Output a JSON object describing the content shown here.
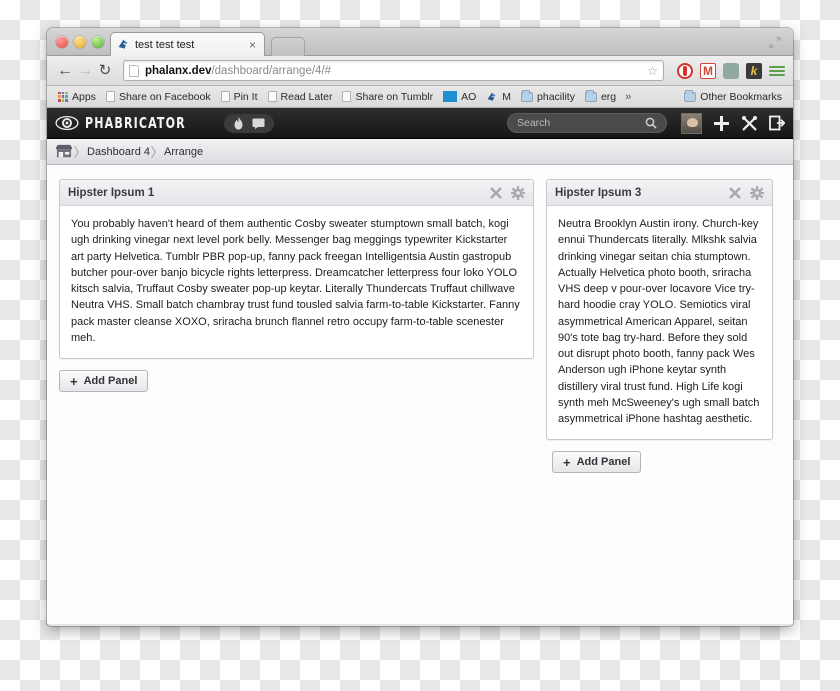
{
  "browser": {
    "tab": {
      "title": "test test test",
      "close_label": "×",
      "favicon": "phabricator-favicon"
    },
    "nav": {
      "back": "←",
      "forward": "→",
      "reload": "↻"
    },
    "url": {
      "host": "phalanx.dev",
      "path": "/dashboard/arrange/4/#"
    },
    "star_label": "☆",
    "extensions": [
      "opera-icon",
      "gmail-icon",
      "evernote-icon",
      "kippt-icon",
      "chrome-menu-icon"
    ],
    "bookmarks": [
      {
        "label": "Apps",
        "icon": "apps-grid-icon"
      },
      {
        "label": "Share on Facebook",
        "icon": "page-icon"
      },
      {
        "label": "Pin It",
        "icon": "page-icon"
      },
      {
        "label": "Read Later",
        "icon": "page-icon"
      },
      {
        "label": "Share on Tumblr",
        "icon": "page-icon"
      },
      {
        "label": "AO",
        "icon": "blue-square-icon"
      },
      {
        "label": "M",
        "icon": "phabricator-favicon"
      },
      {
        "label": "phacility",
        "icon": "folder-icon"
      },
      {
        "label": "erg",
        "icon": "folder-icon"
      }
    ],
    "overflow_label": "»",
    "other_bookmarks": {
      "label": "Other Bookmarks",
      "icon": "folder-icon"
    }
  },
  "phabricator": {
    "logo_text": "PHABRICATOR",
    "logo_icon": "eye-gear-icon",
    "quick_actions": [
      "flame-icon",
      "chat-bubble-icon"
    ],
    "search": {
      "placeholder": "Search",
      "icon": "search-icon"
    },
    "right_actions": [
      "avatar",
      "plus-icon",
      "tools-icon",
      "logout-icon"
    ],
    "breadcrumbs": [
      {
        "label": "",
        "icon": "home-storefront-icon"
      },
      {
        "label": "Dashboard 4"
      },
      {
        "label": "Arrange"
      }
    ],
    "crumb_separator": "〉"
  },
  "dashboard": {
    "columns": [
      {
        "panels": [
          {
            "title": "Hipster Ipsum 1",
            "actions": [
              "close-icon",
              "gear-icon"
            ],
            "body": "You probably haven't heard of them authentic Cosby sweater stumptown small batch, kogi ugh drinking vinegar next level pork belly. Messenger bag meggings typewriter Kickstarter art party Helvetica. Tumblr PBR pop-up, fanny pack freegan Intelligentsia Austin gastropub butcher pour-over banjo bicycle rights letterpress. Dreamcatcher letterpress four loko YOLO kitsch salvia, Truffaut Cosby sweater pop-up keytar. Literally Thundercats Truffaut chillwave Neutra VHS. Small batch chambray trust fund tousled salvia farm-to-table Kickstarter. Fanny pack master cleanse XOXO, sriracha brunch flannel retro occupy farm-to-table scenester meh."
          }
        ],
        "add_panel_label": "Add Panel",
        "add_panel_plus": "+"
      },
      {
        "panels": [
          {
            "title": "Hipster Ipsum 3",
            "actions": [
              "close-icon",
              "gear-icon"
            ],
            "body": "Neutra Brooklyn Austin irony. Church-key ennui Thundercats literally. Mlkshk salvia drinking vinegar seitan chia stumptown. Actually Helvetica photo booth, sriracha VHS deep v pour-over locavore Vice try-hard hoodie cray YOLO. Semiotics viral asymmetrical American Apparel, seitan 90's tote bag try-hard. Before they sold out disrupt photo booth, fanny pack Wes Anderson ugh iPhone keytar synth distillery viral trust fund. High Life kogi synth meh McSweeney's ugh small batch asymmetrical iPhone hashtag aesthetic."
          }
        ],
        "add_panel_label": "Add Panel",
        "add_panel_plus": "+"
      }
    ]
  },
  "colors": {
    "phab_bar": "#1d1d1d",
    "panel_border": "#c8c8cd",
    "accent_green": "#5aa14a"
  }
}
